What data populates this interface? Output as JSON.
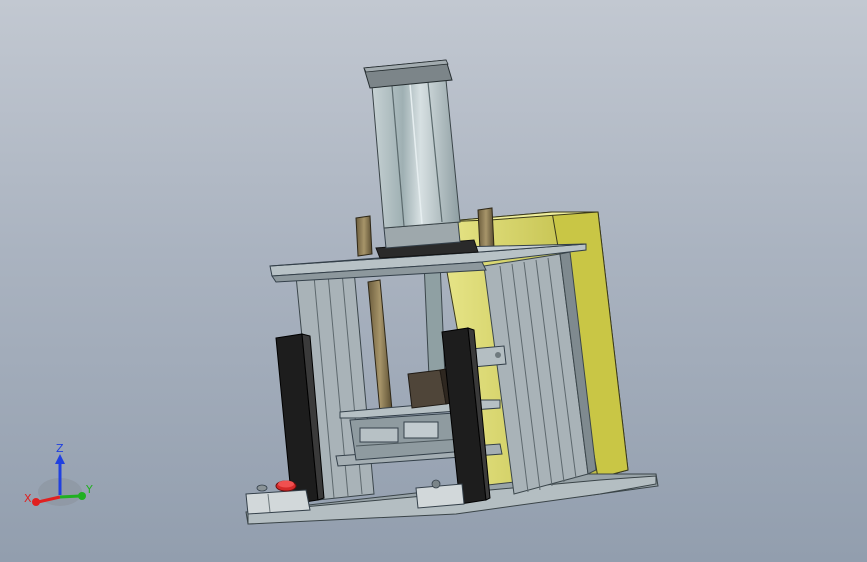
{
  "viewport": {
    "background_top": "#c2c8d1",
    "background_bottom": "#929eae"
  },
  "triad": {
    "x_label": "X",
    "y_label": "Y",
    "z_label": "Z",
    "x_color": "#e02020",
    "y_color": "#20b020",
    "z_color": "#2040e0"
  },
  "model": {
    "frame_color": "#a7b1b6",
    "cylinder_color": "#b6c2c4",
    "enclosure_color": "#d6d45a",
    "dark_part_color": "#1e1e1e",
    "button_color": "#d42a2a"
  }
}
